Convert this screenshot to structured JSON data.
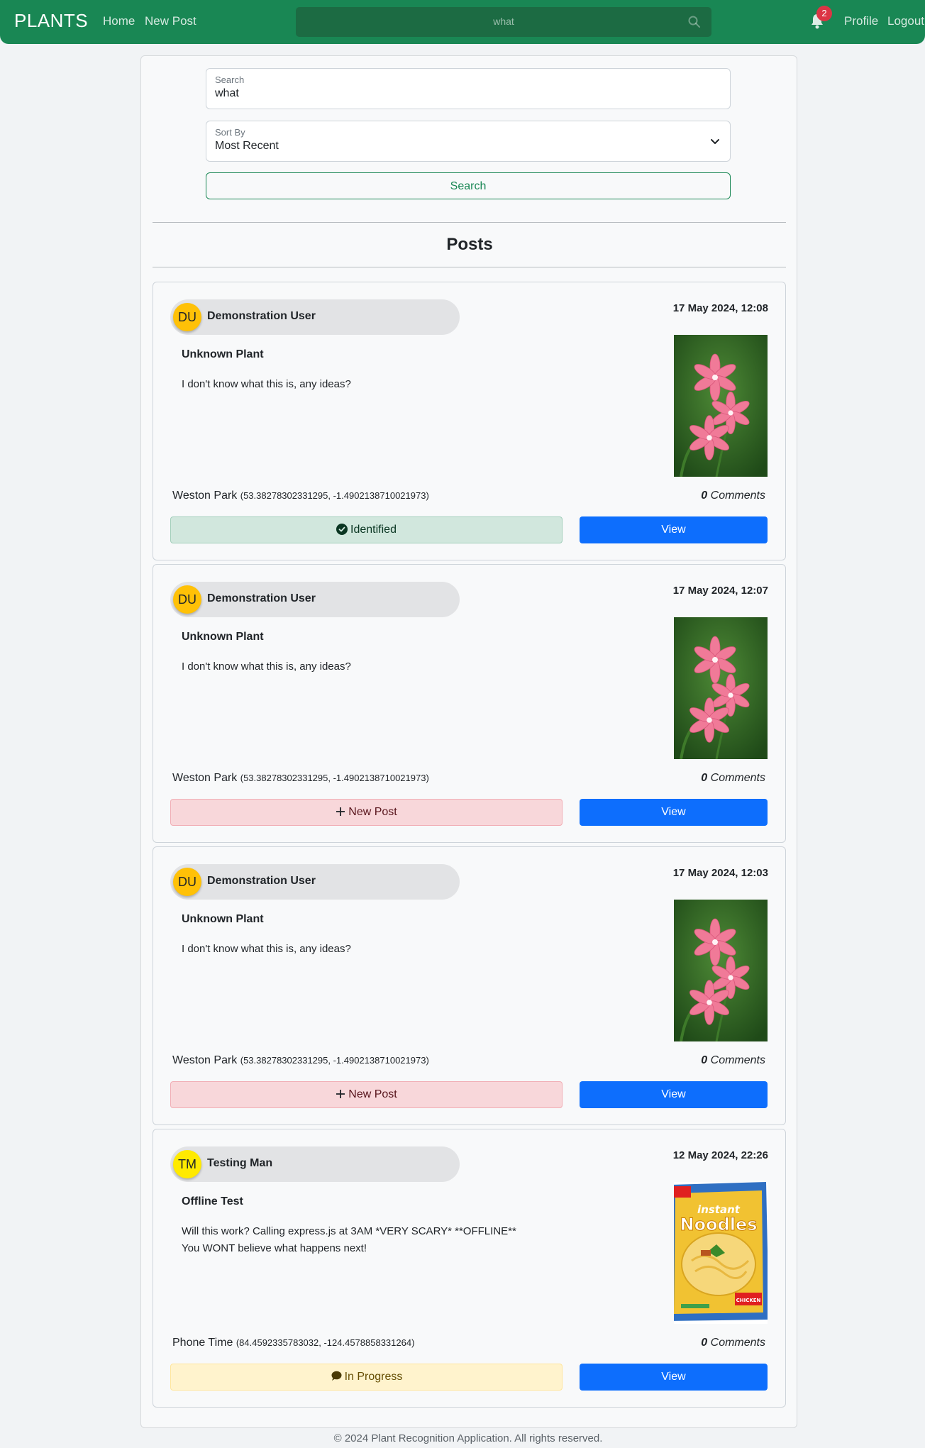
{
  "navbar": {
    "brand": "PLANTS",
    "links": {
      "home": "Home",
      "new_post": "New Post",
      "profile": "Profile",
      "logout": "Logout"
    },
    "search_value": "what",
    "notification_count": "2"
  },
  "search_form": {
    "search_label": "Search",
    "search_value": "what",
    "sort_label": "Sort By",
    "sort_value": "Most Recent",
    "button_label": "Search"
  },
  "posts_heading": "Posts",
  "posts": [
    {
      "avatar_initials": "DU",
      "username": "Demonstration User",
      "date": "17 May 2024, 12:08",
      "title": "Unknown Plant",
      "description": [
        "I don't know what this is, any ideas?"
      ],
      "location": "Weston Park",
      "coords": "(53.38278302331295, -1.4902138710021973)",
      "comment_count": "0",
      "comments_label": "Comments",
      "status": "Identified",
      "status_type": "identified",
      "view_label": "View",
      "image": "flower"
    },
    {
      "avatar_initials": "DU",
      "username": "Demonstration User",
      "date": "17 May 2024, 12:07",
      "title": "Unknown Plant",
      "description": [
        "I don't know what this is, any ideas?"
      ],
      "location": "Weston Park",
      "coords": "(53.38278302331295, -1.4902138710021973)",
      "comment_count": "0",
      "comments_label": "Comments",
      "status": "New Post",
      "status_type": "new",
      "view_label": "View",
      "image": "flower"
    },
    {
      "avatar_initials": "DU",
      "username": "Demonstration User",
      "date": "17 May 2024, 12:03",
      "title": "Unknown Plant",
      "description": [
        "I don't know what this is, any ideas?"
      ],
      "location": "Weston Park",
      "coords": "(53.38278302331295, -1.4902138710021973)",
      "comment_count": "0",
      "comments_label": "Comments",
      "status": "New Post",
      "status_type": "new",
      "view_label": "View",
      "image": "flower"
    },
    {
      "avatar_initials": "TM",
      "username": "Testing Man",
      "date": "12 May 2024, 22:26",
      "title": "Offline Test",
      "description": [
        "Will this work? Calling express.js at 3AM *VERY SCARY* **OFFLINE**",
        "You WONT believe what happens next!"
      ],
      "location": "Phone Time",
      "coords": "(84.4592335783032, -124.4578858331264)",
      "comment_count": "0",
      "comments_label": "Comments",
      "status": "In Progress",
      "status_type": "progress",
      "view_label": "View",
      "image": "noodles",
      "image_text": [
        "instant",
        "Noodles",
        "CHICKEN"
      ]
    }
  ],
  "colors": {
    "navbar": "#198754",
    "primary": "#0d6efd",
    "avatar_du": "#ffc107",
    "avatar_tm": "#ffea00"
  },
  "footer": "© 2024 Plant Recognition Application. All rights reserved."
}
